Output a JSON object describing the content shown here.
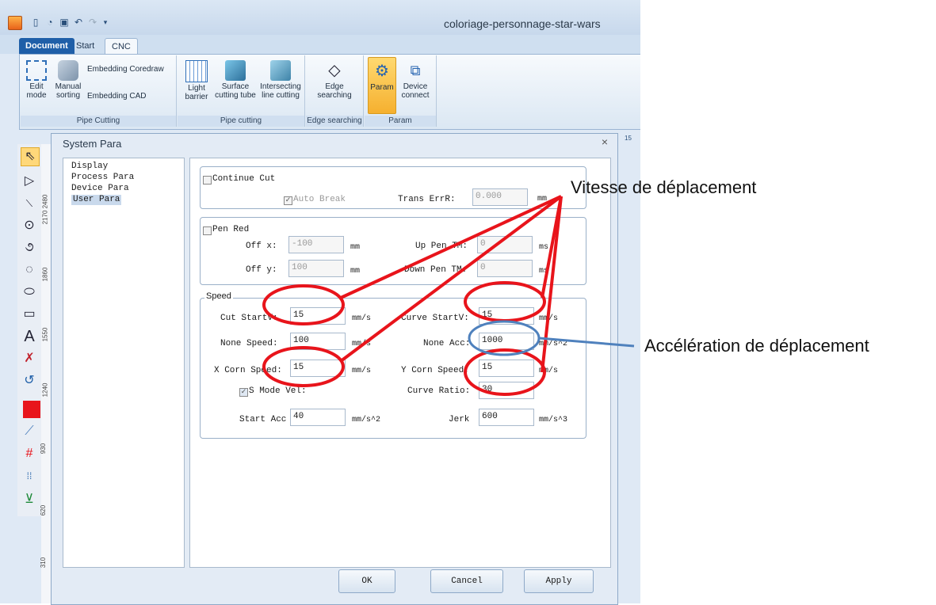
{
  "window": {
    "title": "coloriage-personnage-star-wars"
  },
  "tabs": [
    "Document",
    "Start",
    "CNC"
  ],
  "ribbon": {
    "groups": [
      {
        "label": "Pipe Cutting",
        "buttons": [
          "Edit mode",
          "Manual sorting",
          "Embedding Coredraw",
          "Embedding CAD"
        ]
      },
      {
        "label": "Pipe cutting",
        "buttons": [
          "Light barrier",
          "Surface cutting tube",
          "Intersecting line cutting"
        ]
      },
      {
        "label": "Edge searching",
        "buttons": [
          "Edge searching"
        ]
      },
      {
        "label": "Param",
        "buttons": [
          "Param",
          "Device connect"
        ]
      }
    ]
  },
  "ruler": {
    "marks": [
      "2480",
      "2170",
      "1860",
      "1550",
      "1240",
      "930",
      "620",
      "310"
    ],
    "top_mark": "15"
  },
  "dialog": {
    "title": "System Para",
    "close": "×",
    "tree": [
      "Display",
      "Process Para",
      "Device Para",
      "User Para"
    ],
    "continue_cut": {
      "label": "Continue Cut",
      "auto_break": "Auto Break",
      "trans_err_label": "Trans ErrR:",
      "trans_err_value": "0.000",
      "trans_err_unit": "mm"
    },
    "pen_red": {
      "label": "Pen Red",
      "off_x_label": "Off x:",
      "off_x_value": "-100",
      "off_x_unit": "mm",
      "off_y_label": "Off y:",
      "off_y_value": "100",
      "off_y_unit": "mm",
      "up_pen_label": "Up Pen TM:",
      "up_pen_value": "0",
      "up_pen_unit": "ms",
      "down_pen_label": "Down Pen TM:",
      "down_pen_value": "0",
      "down_pen_unit": "ms"
    },
    "speed": {
      "label": "Speed",
      "cut_startv_label": "Cut StartV:",
      "cut_startv_value": "15",
      "cut_startv_unit": "mm/s",
      "curve_startv_label": "Curve StartV:",
      "curve_startv_value": "15",
      "curve_startv_unit": "mm/s",
      "none_speed_label": "None Speed:",
      "none_speed_value": "100",
      "none_speed_unit": "mm/s",
      "none_acc_label": "None Acc:",
      "none_acc_value": "1000",
      "none_acc_unit": "mm/s^2",
      "x_corn_label": "X Corn Speed:",
      "x_corn_value": "15",
      "x_corn_unit": "mm/s",
      "y_corn_label": "Y Corn Speed:",
      "y_corn_value": "15",
      "y_corn_unit": "mm/s",
      "s_mode_label": "S Mode Vel:",
      "curve_ratio_label": "Curve Ratio:",
      "curve_ratio_value": "30",
      "start_acc_label": "Start Acc",
      "start_acc_value": "40",
      "start_acc_unit": "mm/s^2",
      "jerk_label": "Jerk",
      "jerk_value": "600",
      "jerk_unit": "mm/s^3"
    },
    "buttons": {
      "ok": "OK",
      "cancel": "Cancel",
      "apply": "Apply"
    }
  },
  "annotations": {
    "vitesse": "Vitesse de déplacement",
    "acceleration": "Accélération de déplacement",
    "red_color": "#e8141b",
    "blue_color": "#4f81bd"
  }
}
